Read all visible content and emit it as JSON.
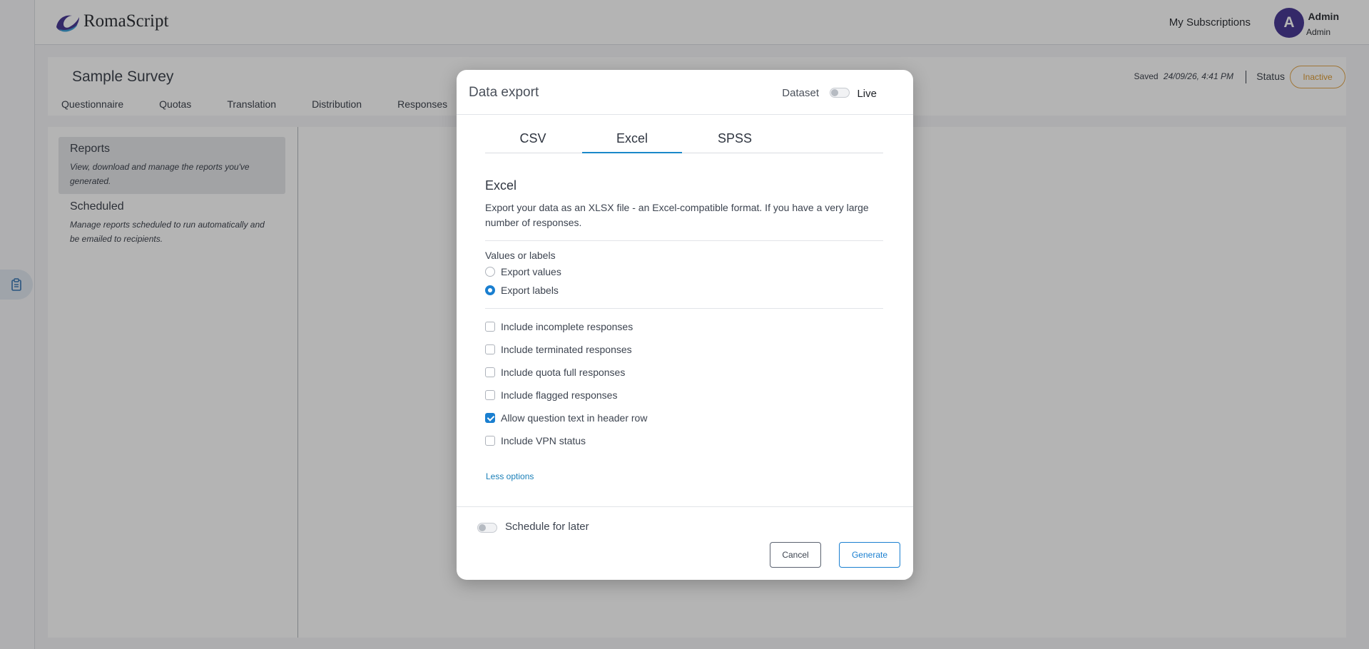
{
  "app": {
    "logo_text": "RomaScript",
    "nav_subscriptions": "My Subscriptions",
    "user": {
      "initial": "A",
      "name": "Admin",
      "role": "Admin"
    },
    "brand_color": "#3b2a8c"
  },
  "survey": {
    "title": "Sample Survey",
    "tabs": [
      "Questionnaire",
      "Quotas",
      "Translation",
      "Distribution",
      "Responses"
    ],
    "saved_label": "Saved",
    "saved_time": "24/09/26, 4:41 PM",
    "status_label": "Status",
    "status_value": "Inactive",
    "status_color": "#d99324"
  },
  "reports_side": {
    "items": [
      {
        "title": "Reports",
        "desc": "View, download and manage the reports you've generated."
      },
      {
        "title": "Scheduled",
        "desc": "Manage reports scheduled to run automatically and be emailed to recipients."
      }
    ]
  },
  "modal": {
    "title": "Data export",
    "dataset_label": "Dataset",
    "dataset_toggle_on": false,
    "live_label": "Live",
    "tabs": [
      "CSV",
      "Excel",
      "SPSS"
    ],
    "active_tab": "Excel",
    "section_title": "Excel",
    "section_desc": "Export your data as an XLSX file - an Excel-compatible format. If you have a very large number of responses.",
    "values_group_label": "Values or labels",
    "radio_options": [
      {
        "label": "Export values",
        "checked": false
      },
      {
        "label": "Export labels",
        "checked": true
      }
    ],
    "checkboxes": [
      {
        "label": "Include incomplete responses",
        "checked": false
      },
      {
        "label": "Include terminated responses",
        "checked": false
      },
      {
        "label": "Include quota full responses",
        "checked": false
      },
      {
        "label": "Include flagged responses",
        "checked": false
      },
      {
        "label": "Allow question text in header row",
        "checked": true
      },
      {
        "label": "Include VPN status",
        "checked": false
      }
    ],
    "less_options": "Less options",
    "schedule_label": "Schedule for later",
    "schedule_toggle_on": false,
    "cancel_label": "Cancel",
    "generate_label": "Generate",
    "accent_color": "#1a7fd0"
  }
}
